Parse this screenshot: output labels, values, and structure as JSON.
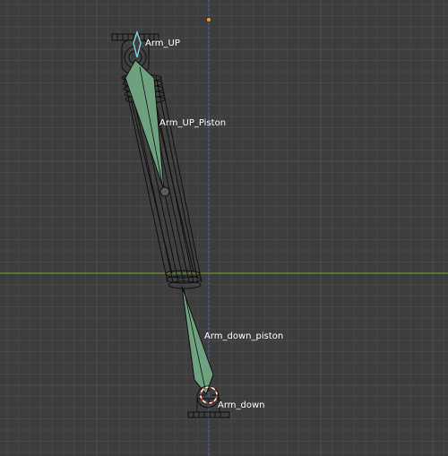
{
  "viewport": {
    "background": "#3d3d3d",
    "grid_minor_color": "#474747",
    "grid_major_color": "#505050",
    "x_axis_color": "#6f8b3c",
    "z_axis_color": "#4b5fa0"
  },
  "bones": [
    {
      "name": "Arm_UP",
      "color": "#7fd2e3"
    },
    {
      "name": "Arm_UP_Piston",
      "color": "#6ea27f"
    },
    {
      "name": "Arm_down_piston",
      "color": "#6ea27f"
    },
    {
      "name": "Arm_down",
      "color": "#d23a3a"
    }
  ],
  "origin_marker": {
    "color": "#f0951e"
  },
  "icons": {
    "cursor": "3d-cursor-icon",
    "origin": "object-origin-icon"
  }
}
